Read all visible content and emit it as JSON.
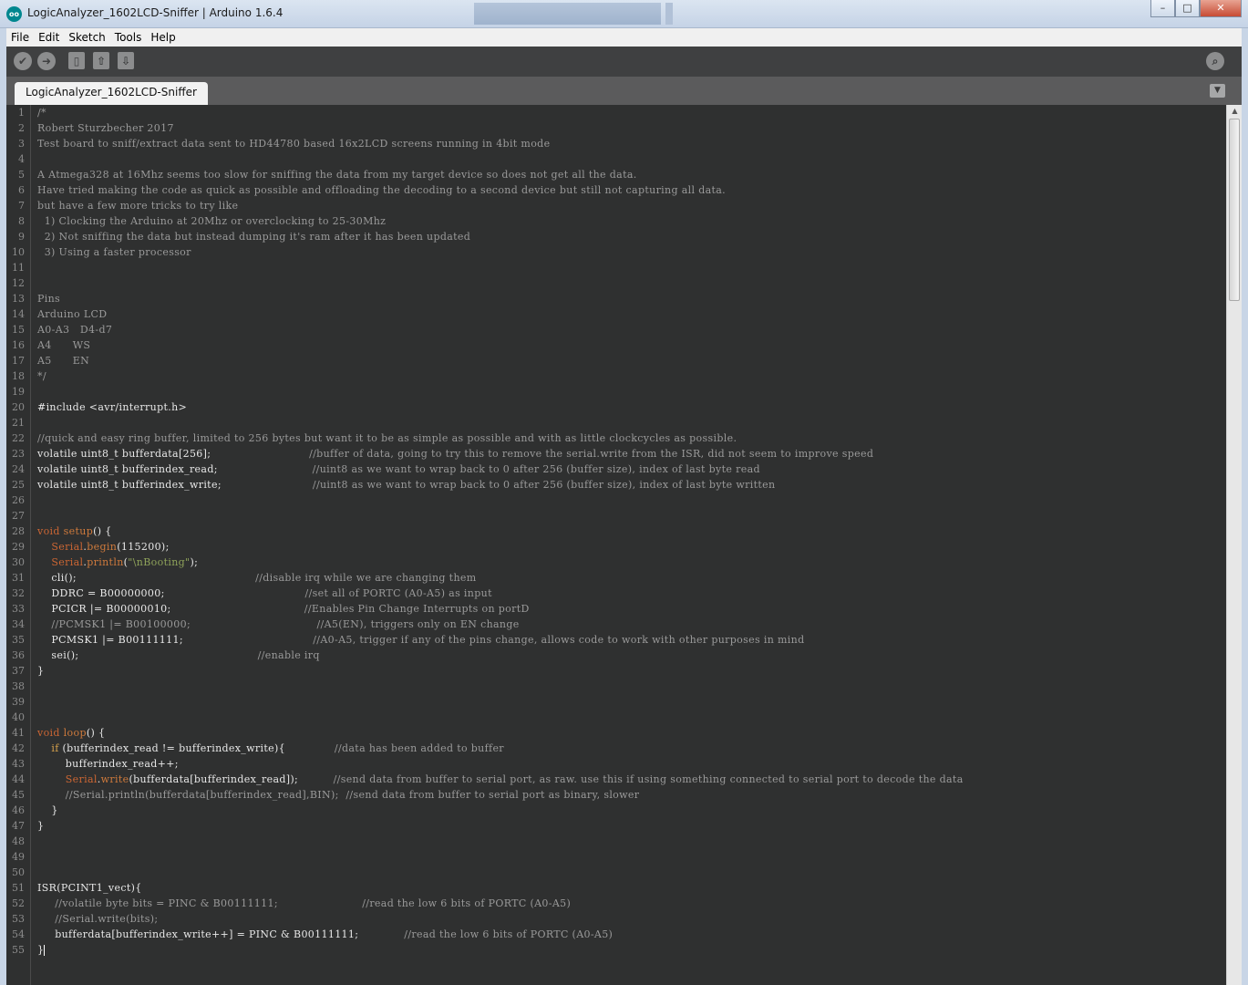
{
  "window": {
    "title": "LogicAnalyzer_1602LCD-Sniffer | Arduino 1.6.4",
    "logo": "oo",
    "minimize": "–",
    "maximize": "□",
    "close": "✕"
  },
  "menu": [
    "File",
    "Edit",
    "Sketch",
    "Tools",
    "Help"
  ],
  "toolbar": {
    "verify_icon": "✔",
    "upload_icon": "➜",
    "new_icon": "▯",
    "open_icon": "⇧",
    "save_icon": "⇩",
    "serial_monitor_icon": "⌕"
  },
  "tabs": {
    "active": "LogicAnalyzer_1602LCD-Sniffer",
    "menu_icon": "▼"
  },
  "scrollbar": {
    "up_icon": "▲"
  },
  "code": [
    [
      {
        "c": "cmt",
        "t": "/*"
      }
    ],
    [
      {
        "c": "cmt",
        "t": "Robert Sturzbecher 2017"
      }
    ],
    [
      {
        "c": "cmt",
        "t": "Test board to sniff/extract data sent to HD44780 based 16x2LCD screens running in 4bit mode"
      }
    ],
    [
      {
        "c": "cmt",
        "t": ""
      }
    ],
    [
      {
        "c": "cmt",
        "t": "A Atmega328 at 16Mhz seems too slow for sniffing the data from my target device so does not get all the data."
      }
    ],
    [
      {
        "c": "cmt",
        "t": "Have tried making the code as quick as possible and offloading the decoding to a second device but still not capturing all data."
      }
    ],
    [
      {
        "c": "cmt",
        "t": "but have a few more tricks to try like"
      }
    ],
    [
      {
        "c": "cmt",
        "t": "  1) Clocking the Arduino at 20Mhz or overclocking to 25-30Mhz"
      }
    ],
    [
      {
        "c": "cmt",
        "t": "  2) Not sniffing the data but instead dumping it's ram after it has been updated"
      }
    ],
    [
      {
        "c": "cmt",
        "t": "  3) Using a faster processor"
      }
    ],
    [
      {
        "c": "cmt",
        "t": ""
      }
    ],
    [
      {
        "c": "cmt",
        "t": ""
      }
    ],
    [
      {
        "c": "cmt",
        "t": "Pins"
      }
    ],
    [
      {
        "c": "cmt",
        "t": "Arduino LCD"
      }
    ],
    [
      {
        "c": "cmt",
        "t": "A0-A3   D4-d7"
      }
    ],
    [
      {
        "c": "cmt",
        "t": "A4      WS"
      }
    ],
    [
      {
        "c": "cmt",
        "t": "A5      EN"
      }
    ],
    [
      {
        "c": "cmt",
        "t": "*/"
      }
    ],
    [
      {
        "c": "",
        "t": ""
      }
    ],
    [
      {
        "c": "",
        "t": "#include <avr/interrupt.h>"
      }
    ],
    [
      {
        "c": "",
        "t": ""
      }
    ],
    [
      {
        "c": "cmt",
        "t": "//quick and easy ring buffer, limited to 256 bytes but want it to be as simple as possible and with as little clockcycles as possible."
      }
    ],
    [
      {
        "c": "",
        "t": "volatile uint8_t bufferdata[256];                            "
      },
      {
        "c": "cmt",
        "t": "//buffer of data, going to try this to remove the serial.write from the ISR, did not seem to improve speed"
      }
    ],
    [
      {
        "c": "",
        "t": "volatile uint8_t bufferindex_read;                           "
      },
      {
        "c": "cmt",
        "t": "//uint8 as we want to wrap back to 0 after 256 (buffer size), index of last byte read"
      }
    ],
    [
      {
        "c": "",
        "t": "volatile uint8_t bufferindex_write;                          "
      },
      {
        "c": "cmt",
        "t": "//uint8 as we want to wrap back to 0 after 256 (buffer size), index of last byte written"
      }
    ],
    [
      {
        "c": "",
        "t": ""
      }
    ],
    [
      {
        "c": "",
        "t": ""
      }
    ],
    [
      {
        "c": "kw",
        "t": "void"
      },
      {
        "c": "",
        "t": " "
      },
      {
        "c": "fn",
        "t": "setup"
      },
      {
        "c": "",
        "t": "() {"
      }
    ],
    [
      {
        "c": "",
        "t": "    "
      },
      {
        "c": "kw",
        "t": "Serial"
      },
      {
        "c": "",
        "t": "."
      },
      {
        "c": "fn",
        "t": "begin"
      },
      {
        "c": "",
        "t": "(115200);"
      }
    ],
    [
      {
        "c": "",
        "t": "    "
      },
      {
        "c": "kw",
        "t": "Serial"
      },
      {
        "c": "",
        "t": "."
      },
      {
        "c": "fn",
        "t": "println"
      },
      {
        "c": "",
        "t": "("
      },
      {
        "c": "str",
        "t": "\"\\nBooting\""
      },
      {
        "c": "",
        "t": ");"
      }
    ],
    [
      {
        "c": "",
        "t": "    cli();                                                   "
      },
      {
        "c": "cmt",
        "t": "//disable irq while we are changing them"
      }
    ],
    [
      {
        "c": "",
        "t": "    DDRC = B00000000;                                        "
      },
      {
        "c": "cmt",
        "t": "//set all of PORTC (A0-A5) as input"
      }
    ],
    [
      {
        "c": "",
        "t": "    PCICR |= B00000010;                                      "
      },
      {
        "c": "cmt",
        "t": "//Enables Pin Change Interrupts on portD"
      }
    ],
    [
      {
        "c": "",
        "t": "    "
      },
      {
        "c": "cmt",
        "t": "//PCMSK1 |= B00100000;                                    //A5(EN), triggers only on EN change"
      }
    ],
    [
      {
        "c": "",
        "t": "    PCMSK1 |= B00111111;                                     "
      },
      {
        "c": "cmt",
        "t": "//A0-A5, trigger if any of the pins change, allows code to work with other purposes in mind"
      }
    ],
    [
      {
        "c": "",
        "t": "    sei();                                                   "
      },
      {
        "c": "cmt",
        "t": "//enable irq"
      }
    ],
    [
      {
        "c": "",
        "t": "}"
      }
    ],
    [
      {
        "c": "",
        "t": ""
      }
    ],
    [
      {
        "c": "",
        "t": ""
      }
    ],
    [
      {
        "c": "",
        "t": ""
      }
    ],
    [
      {
        "c": "kw",
        "t": "void"
      },
      {
        "c": "",
        "t": " "
      },
      {
        "c": "fn",
        "t": "loop"
      },
      {
        "c": "",
        "t": "() {"
      }
    ],
    [
      {
        "c": "",
        "t": "    "
      },
      {
        "c": "ctl",
        "t": "if"
      },
      {
        "c": "",
        "t": " (bufferindex_read != bufferindex_write){              "
      },
      {
        "c": "cmt",
        "t": "//data has been added to buffer"
      }
    ],
    [
      {
        "c": "",
        "t": "        bufferindex_read++;"
      }
    ],
    [
      {
        "c": "",
        "t": "        "
      },
      {
        "c": "kw",
        "t": "Serial"
      },
      {
        "c": "",
        "t": "."
      },
      {
        "c": "fn",
        "t": "write"
      },
      {
        "c": "",
        "t": "(bufferdata[bufferindex_read]);          "
      },
      {
        "c": "cmt",
        "t": "//send data from buffer to serial port, as raw. use this if using something connected to serial port to decode the data"
      }
    ],
    [
      {
        "c": "",
        "t": "        "
      },
      {
        "c": "cmt",
        "t": "//Serial.println(bufferdata[bufferindex_read],BIN);  //send data from buffer to serial port as binary, slower"
      }
    ],
    [
      {
        "c": "",
        "t": "    }"
      }
    ],
    [
      {
        "c": "",
        "t": "}"
      }
    ],
    [
      {
        "c": "",
        "t": ""
      }
    ],
    [
      {
        "c": "",
        "t": ""
      }
    ],
    [
      {
        "c": "",
        "t": ""
      }
    ],
    [
      {
        "c": "",
        "t": "ISR(PCINT1_vect){"
      }
    ],
    [
      {
        "c": "",
        "t": "     "
      },
      {
        "c": "cmt",
        "t": "//volatile byte bits = PINC & B00111111;                        //read the low 6 bits of PORTC (A0-A5)"
      }
    ],
    [
      {
        "c": "",
        "t": "     "
      },
      {
        "c": "cmt",
        "t": "//Serial.write(bits);"
      }
    ],
    [
      {
        "c": "",
        "t": "     bufferdata[bufferindex_write++] = PINC & B00111111;             "
      },
      {
        "c": "cmt",
        "t": "//read the low 6 bits of PORTC (A0-A5)"
      }
    ],
    [
      {
        "c": "",
        "t": "}"
      }
    ]
  ]
}
